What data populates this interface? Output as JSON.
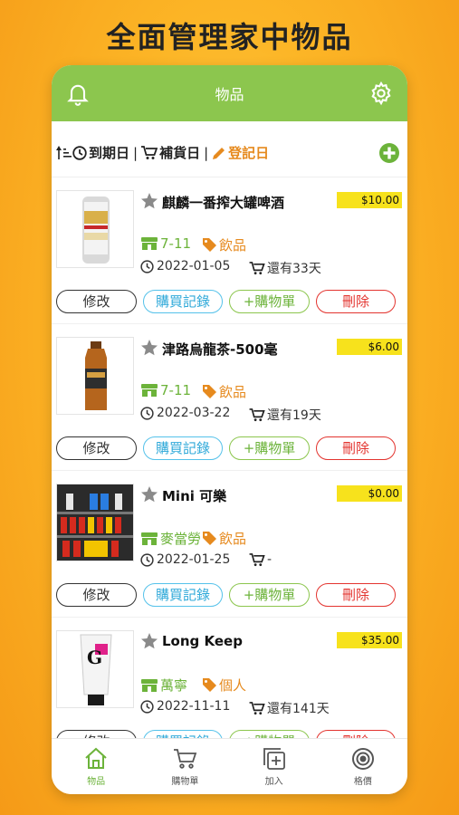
{
  "headline": "全面管理家中物品",
  "navbar": {
    "title": "物品",
    "bell_icon": "bell-icon",
    "settings_icon": "gear-icon"
  },
  "toolbar": {
    "expiry_label": "到期日",
    "restock_label": "補貨日",
    "record_label": "登記日",
    "separator": "|",
    "accent": "#e68a1e"
  },
  "buttons": {
    "edit": "修改",
    "history": "購買記錄",
    "add_cart": "+購物單",
    "delete": "刪除"
  },
  "items": [
    {
      "name": "麒麟一番搾大罐啤酒",
      "price": "$10.00",
      "store": "7-11",
      "category": "飲品",
      "date": "2022-01-05",
      "remaining": "還有33天",
      "thumb": "beer-can"
    },
    {
      "name": "津路烏龍茶-500毫",
      "price": "$6.00",
      "store": "7-11",
      "category": "飲品",
      "date": "2022-03-22",
      "remaining": "還有19天",
      "thumb": "tea-bottle"
    },
    {
      "name": "Mini 可樂",
      "price": "$0.00",
      "store": "麥當勞",
      "category": "飲品",
      "date": "2022-01-25",
      "remaining": "-",
      "thumb": "fridge"
    },
    {
      "name": "Long Keep",
      "price": "$35.00",
      "store": "萬寧",
      "category": "個人",
      "date": "2022-11-11",
      "remaining": "還有141天",
      "thumb": "tube"
    }
  ],
  "tabs": [
    {
      "label": "物品",
      "icon": "home-icon",
      "active": true
    },
    {
      "label": "購物單",
      "icon": "cart-icon",
      "active": false
    },
    {
      "label": "加入",
      "icon": "add-icon",
      "active": false
    },
    {
      "label": "格價",
      "icon": "target-icon",
      "active": false
    }
  ],
  "colors": {
    "brand_green": "#8cc64e",
    "price_yellow": "#f7e21c",
    "delete_red": "#e3342f",
    "history_blue": "#55c2ea"
  }
}
